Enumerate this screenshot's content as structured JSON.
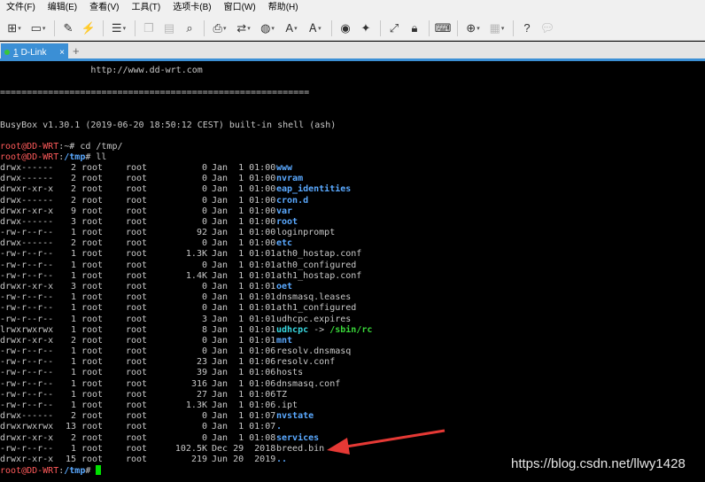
{
  "menu": [
    "文件(F)",
    "编辑(E)",
    "查看(V)",
    "工具(T)",
    "选项卡(B)",
    "窗口(W)",
    "帮助(H)"
  ],
  "toolbar_icons": [
    "new-session-icon",
    "open-folder-icon",
    "pencil-icon",
    "disconnect-icon",
    "properties-icon",
    "copy-icon",
    "paste-icon",
    "find-icon",
    "print-icon",
    "transfer-icon",
    "globe-icon",
    "font-icon",
    "font-size-icon",
    "xftp-icon",
    "xagent-icon",
    "fullscreen-icon",
    "lock-icon",
    "keyboard-icon",
    "add-icon",
    "layout-icon",
    "help-icon",
    "chat-icon"
  ],
  "tab": {
    "number": "1",
    "name": "D-Link",
    "close": "×",
    "add": "+"
  },
  "terminal": {
    "header_url": "                 http://www.dd-wrt.com",
    "divider": "==========================================================",
    "busybox": "BusyBox v1.30.1 (2019-06-20 18:50:12 CEST) built-in shell (ash)",
    "prompt_user": "root@DD-WRT",
    "cmd1_path": ":~",
    "cmd1_rest": "# cd /tmp/",
    "cmd2_path": "/tmp",
    "cmd2_rest": "# ll",
    "prompt_colon": ":",
    "final_path": "/tmp",
    "final_hash": "#",
    "listing": [
      {
        "perm": "drwx------",
        "links": "2",
        "owner": "root",
        "group": "root",
        "size": "0",
        "date": "Jan  1 01:00",
        "name": "www",
        "color": "blue"
      },
      {
        "perm": "drwx------",
        "links": "2",
        "owner": "root",
        "group": "root",
        "size": "0",
        "date": "Jan  1 01:00",
        "name": "nvram",
        "color": "blue"
      },
      {
        "perm": "drwxr-xr-x",
        "links": "2",
        "owner": "root",
        "group": "root",
        "size": "0",
        "date": "Jan  1 01:00",
        "name": "eap_identities",
        "color": "blue"
      },
      {
        "perm": "drwx------",
        "links": "2",
        "owner": "root",
        "group": "root",
        "size": "0",
        "date": "Jan  1 01:00",
        "name": "cron.d",
        "color": "blue"
      },
      {
        "perm": "drwxr-xr-x",
        "links": "9",
        "owner": "root",
        "group": "root",
        "size": "0",
        "date": "Jan  1 01:00",
        "name": "var",
        "color": "blue"
      },
      {
        "perm": "drwx------",
        "links": "3",
        "owner": "root",
        "group": "root",
        "size": "0",
        "date": "Jan  1 01:00",
        "name": "root",
        "color": "blue"
      },
      {
        "perm": "-rw-r--r--",
        "links": "1",
        "owner": "root",
        "group": "root",
        "size": "92",
        "date": "Jan  1 01:00",
        "name": "loginprompt",
        "color": "plain"
      },
      {
        "perm": "drwx------",
        "links": "2",
        "owner": "root",
        "group": "root",
        "size": "0",
        "date": "Jan  1 01:00",
        "name": "etc",
        "color": "blue"
      },
      {
        "perm": "-rw-r--r--",
        "links": "1",
        "owner": "root",
        "group": "root",
        "size": "1.3K",
        "date": "Jan  1 01:01",
        "name": "ath0_hostap.conf",
        "color": "plain"
      },
      {
        "perm": "-rw-r--r--",
        "links": "1",
        "owner": "root",
        "group": "root",
        "size": "0",
        "date": "Jan  1 01:01",
        "name": "ath0_configured",
        "color": "plain"
      },
      {
        "perm": "-rw-r--r--",
        "links": "1",
        "owner": "root",
        "group": "root",
        "size": "1.4K",
        "date": "Jan  1 01:01",
        "name": "ath1_hostap.conf",
        "color": "plain"
      },
      {
        "perm": "drwxr-xr-x",
        "links": "3",
        "owner": "root",
        "group": "root",
        "size": "0",
        "date": "Jan  1 01:01",
        "name": "oet",
        "color": "blue"
      },
      {
        "perm": "-rw-r--r--",
        "links": "1",
        "owner": "root",
        "group": "root",
        "size": "0",
        "date": "Jan  1 01:01",
        "name": "dnsmasq.leases",
        "color": "plain"
      },
      {
        "perm": "-rw-r--r--",
        "links": "1",
        "owner": "root",
        "group": "root",
        "size": "0",
        "date": "Jan  1 01:01",
        "name": "ath1_configured",
        "color": "plain"
      },
      {
        "perm": "-rw-r--r--",
        "links": "1",
        "owner": "root",
        "group": "root",
        "size": "3",
        "date": "Jan  1 01:01",
        "name": "udhcpc.expires",
        "color": "plain"
      },
      {
        "perm": "lrwxrwxrwx",
        "links": "1",
        "owner": "root",
        "group": "root",
        "size": "8",
        "date": "Jan  1 01:01",
        "name": "udhcpc",
        "color": "cyan",
        "link_arrow": " -> ",
        "link_target": "/sbin/rc"
      },
      {
        "perm": "drwxr-xr-x",
        "links": "2",
        "owner": "root",
        "group": "root",
        "size": "0",
        "date": "Jan  1 01:01",
        "name": "mnt",
        "color": "blue"
      },
      {
        "perm": "-rw-r--r--",
        "links": "1",
        "owner": "root",
        "group": "root",
        "size": "0",
        "date": "Jan  1 01:06",
        "name": "resolv.dnsmasq",
        "color": "plain"
      },
      {
        "perm": "-rw-r--r--",
        "links": "1",
        "owner": "root",
        "group": "root",
        "size": "23",
        "date": "Jan  1 01:06",
        "name": "resolv.conf",
        "color": "plain"
      },
      {
        "perm": "-rw-r--r--",
        "links": "1",
        "owner": "root",
        "group": "root",
        "size": "39",
        "date": "Jan  1 01:06",
        "name": "hosts",
        "color": "plain"
      },
      {
        "perm": "-rw-r--r--",
        "links": "1",
        "owner": "root",
        "group": "root",
        "size": "316",
        "date": "Jan  1 01:06",
        "name": "dnsmasq.conf",
        "color": "plain"
      },
      {
        "perm": "-rw-r--r--",
        "links": "1",
        "owner": "root",
        "group": "root",
        "size": "27",
        "date": "Jan  1 01:06",
        "name": "TZ",
        "color": "plain"
      },
      {
        "perm": "-rw-r--r--",
        "links": "1",
        "owner": "root",
        "group": "root",
        "size": "1.3K",
        "date": "Jan  1 01:06",
        "name": ".ipt",
        "color": "plain"
      },
      {
        "perm": "drwx------",
        "links": "2",
        "owner": "root",
        "group": "root",
        "size": "0",
        "date": "Jan  1 01:07",
        "name": "nvstate",
        "color": "blue"
      },
      {
        "perm": "drwxrwxrwx",
        "links": "13",
        "owner": "root",
        "group": "root",
        "size": "0",
        "date": "Jan  1 01:07",
        "name": ".",
        "color": "blue"
      },
      {
        "perm": "drwxr-xr-x",
        "links": "2",
        "owner": "root",
        "group": "root",
        "size": "0",
        "date": "Jan  1 01:08",
        "name": "services",
        "color": "blue"
      },
      {
        "perm": "-rw-r--r--",
        "links": "1",
        "owner": "root",
        "group": "root",
        "size": "102.5K",
        "date": "Dec 29  2018",
        "name": "breed.bin",
        "color": "plain"
      },
      {
        "perm": "drwxr-xr-x",
        "links": "15",
        "owner": "root",
        "group": "root",
        "size": "219",
        "date": "Jun 20  2019",
        "name": "..",
        "color": "blue"
      }
    ]
  },
  "watermark": "https://blog.csdn.net/llwy1428",
  "colors": {
    "tab_active": "#3b8fd5",
    "prompt": "#ff5a5a",
    "dir": "#5aa9ff",
    "symlink": "#38d8e0",
    "exec": "#3ad83a",
    "arrow": "#e53935"
  }
}
